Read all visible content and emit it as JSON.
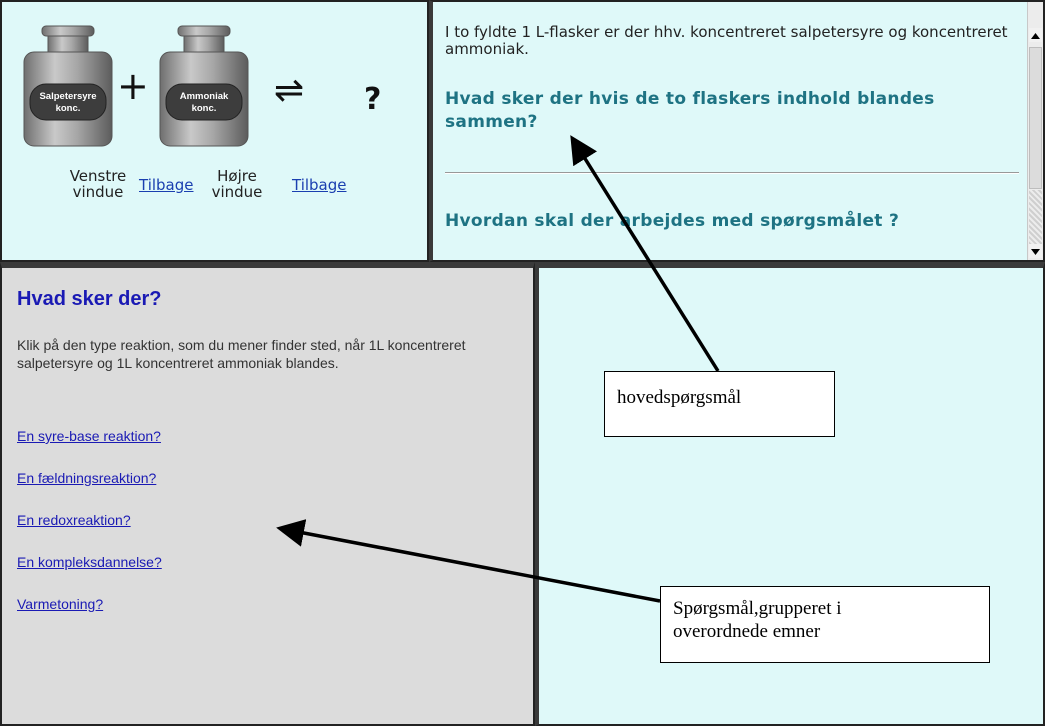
{
  "top_left": {
    "bottle_left_label": [
      "Salpetersyre",
      "konc."
    ],
    "bottle_right_label": [
      "Ammoniak",
      "konc."
    ],
    "plus_symbol": "+",
    "equilibrium_symbol": "⇌",
    "question_symbol": "?",
    "left_window_label": "Venstre vindue",
    "left_back_link": "Tilbage",
    "right_window_label": "Højre vindue",
    "right_back_link": "Tilbage"
  },
  "top_right": {
    "intro_text": "I to fyldte 1 L-flasker er der hhv. koncentreret salpetersyre og koncentreret ammoniak.",
    "main_question": "Hvad sker der hvis de to flaskers indhold blandes sammen?",
    "how_to_question": "Hvordan skal der arbejdes med spørgsmålet ?"
  },
  "bottom_left": {
    "title": "Hvad sker der?",
    "instruction": "Klik på den type reaktion, som du mener finder sted, når 1L koncentreret salpetersyre og 1L koncentreret ammoniak blandes.",
    "options": [
      "En syre-base reaktion?",
      "En fældningsreaktion?",
      "En redoxreaktion?",
      "En kompleksdannelse?",
      "Varmetoning?"
    ]
  },
  "annotations": {
    "main_question_label": "hovedspørgsmål",
    "grouped_questions_label": [
      "Spørgsmål,grupperet i",
      "overordnede emner"
    ]
  },
  "colors": {
    "frame_bg": "#dff9f9",
    "left_bg": "#dcdcdc",
    "question_teal": "#1e7383",
    "link_blue": "#1a1ab4"
  }
}
